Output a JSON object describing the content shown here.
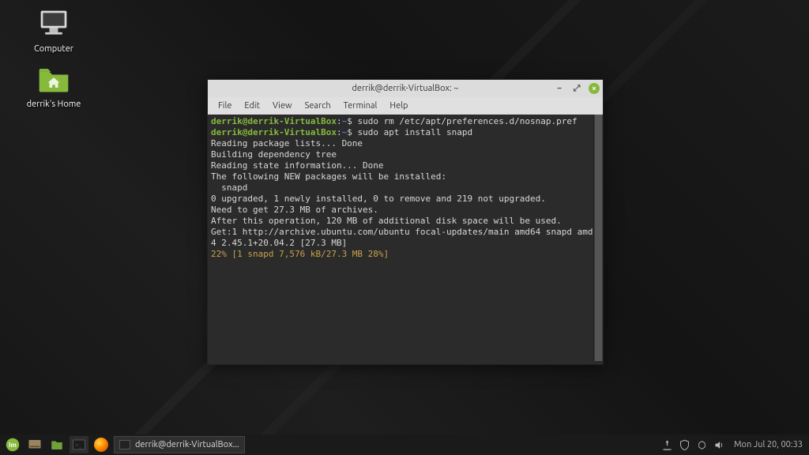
{
  "desktop": {
    "icons": [
      {
        "label": "Computer"
      },
      {
        "label": "derrik's Home"
      }
    ]
  },
  "window": {
    "title": "derrik@derrik-VirtualBox: ~",
    "menu": [
      "File",
      "Edit",
      "View",
      "Search",
      "Terminal",
      "Help"
    ]
  },
  "terminal": {
    "prompt_user": "derrik@derrik-VirtualBox",
    "prompt_path": "~",
    "lines": [
      {
        "type": "cmd",
        "text": "sudo rm /etc/apt/preferences.d/nosnap.pref"
      },
      {
        "type": "cmd",
        "text": "sudo apt install snapd"
      },
      {
        "type": "out",
        "text": "Reading package lists... Done"
      },
      {
        "type": "out",
        "text": "Building dependency tree"
      },
      {
        "type": "out",
        "text": "Reading state information... Done"
      },
      {
        "type": "out",
        "text": "The following NEW packages will be installed:"
      },
      {
        "type": "out",
        "text": "  snapd"
      },
      {
        "type": "out",
        "text": "0 upgraded, 1 newly installed, 0 to remove and 219 not upgraded."
      },
      {
        "type": "out",
        "text": "Need to get 27.3 MB of archives."
      },
      {
        "type": "out",
        "text": "After this operation, 120 MB of additional disk space will be used."
      },
      {
        "type": "out",
        "text": "Get:1 http://archive.ubuntu.com/ubuntu focal-updates/main amd64 snapd amd64 2.45.1+20.04.2 [27.3 MB]"
      },
      {
        "type": "progress",
        "text": "22% [1 snapd 7,576 kB/27.3 MB 28%]"
      }
    ]
  },
  "taskbar": {
    "task_label": "derrik@derrik-VirtualBox...",
    "clock": "Mon Jul 20, 00:33"
  }
}
